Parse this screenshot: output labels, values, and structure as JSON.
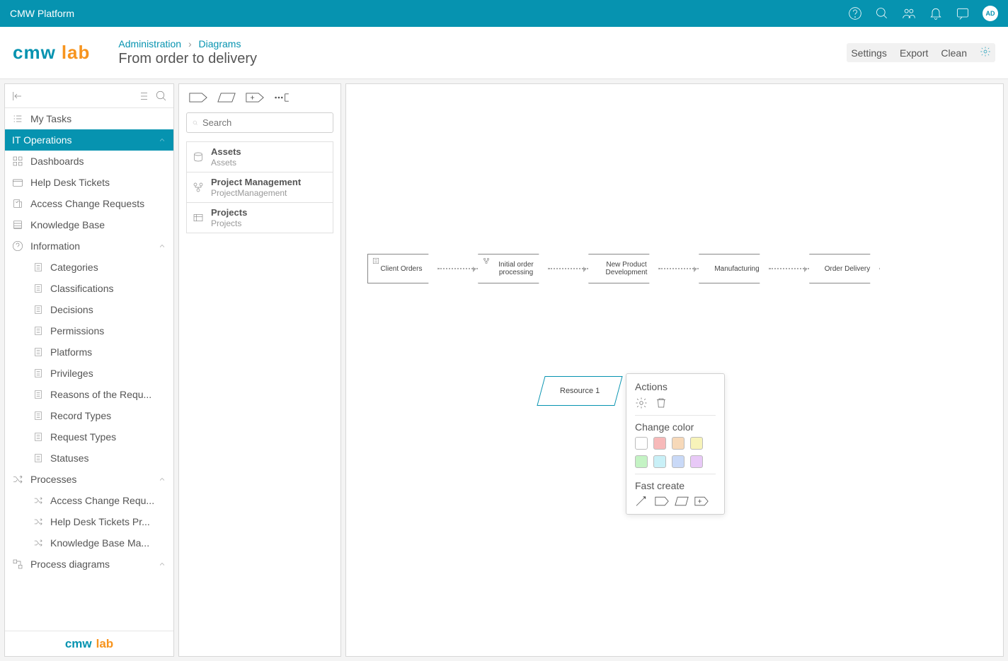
{
  "topbar": {
    "title": "CMW Platform",
    "avatar": "AD"
  },
  "breadcrumb": {
    "root": "Administration",
    "page": "Diagrams"
  },
  "page_title": "From order to delivery",
  "header_actions": {
    "settings": "Settings",
    "export": "Export",
    "clean": "Clean"
  },
  "sidebar": {
    "my_tasks": "My Tasks",
    "it_ops": "IT Operations",
    "items": [
      "Dashboards",
      "Help Desk Tickets",
      "Access Change Requests",
      "Knowledge Base"
    ],
    "information": "Information",
    "info_items": [
      "Categories",
      "Classifications",
      "Decisions",
      "Permissions",
      "Platforms",
      "Privileges",
      "Reasons of the Requ...",
      "Record Types",
      "Request Types",
      "Statuses"
    ],
    "processes": "Processes",
    "process_items": [
      "Access Change Requ...",
      "Help Desk Tickets Pr...",
      "Knowledge Base Ma..."
    ],
    "process_diagrams": "Process diagrams"
  },
  "search_placeholder": "Search",
  "assets": [
    {
      "title": "Assets",
      "sub": "Assets"
    },
    {
      "title": "Project Management",
      "sub": "ProjectManagement"
    },
    {
      "title": "Projects",
      "sub": "Projects"
    }
  ],
  "flow": [
    "Client Orders",
    "Initial order processing",
    "New Product Development",
    "Manufacturing",
    "Order Delivery"
  ],
  "resource": "Resource 1",
  "popup": {
    "actions": "Actions",
    "change_color": "Change color",
    "fast_create": "Fast create",
    "colors": [
      "#ffffff",
      "#f7b9b9",
      "#f7d9b9",
      "#f7f3b9",
      "#c4f3c4",
      "#c9f0f7",
      "#c9d9f7",
      "#e8c9f7"
    ]
  }
}
